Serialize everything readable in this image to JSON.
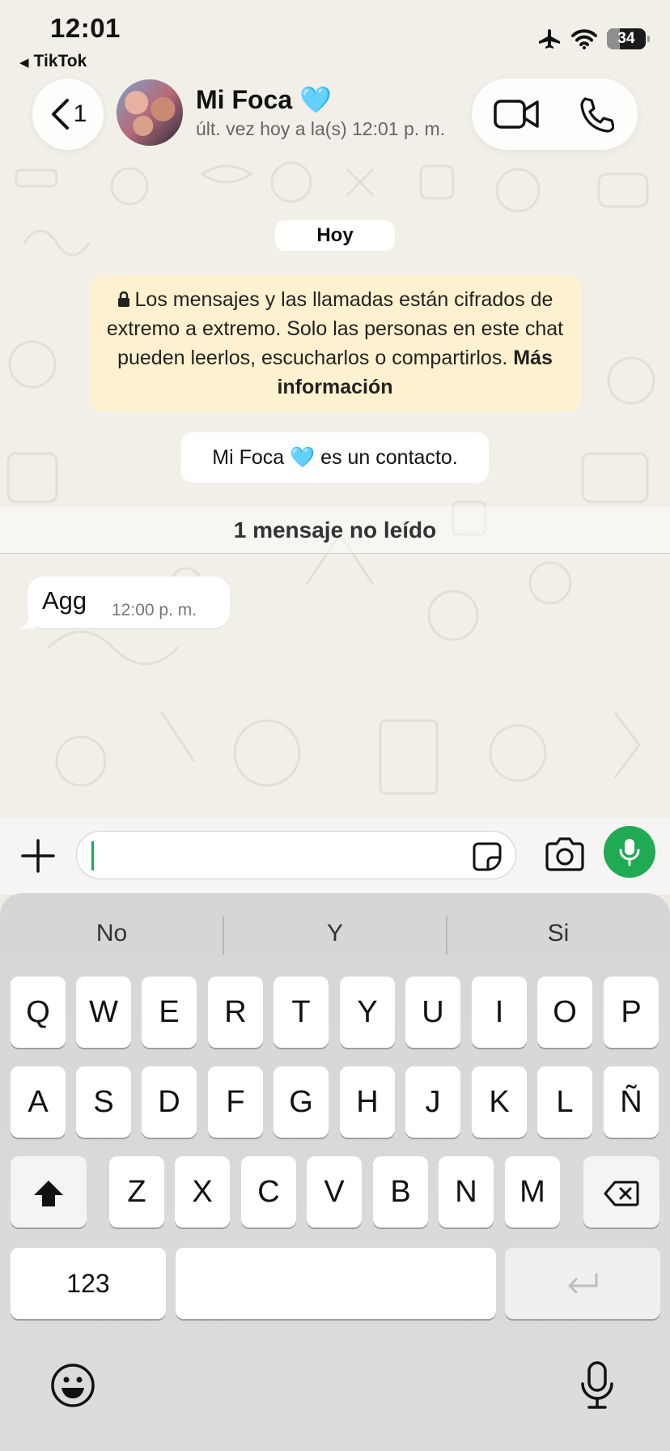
{
  "status_bar": {
    "time": "12:01",
    "back_app": "TikTok",
    "battery": "34",
    "battery_level": 0.34
  },
  "header": {
    "back_count": "1",
    "contact_name": "Mi Foca 🩵",
    "contact_status": "últ. vez hoy a la(s) 12:01 p. m."
  },
  "chat": {
    "date_label": "Hoy",
    "encryption_text": "Los mensajes y las llamadas están cifrados de extremo a extremo. Solo las personas en este chat pueden leerlos, escucharlos o compartirlos.",
    "encryption_link": "Más información",
    "contact_notice": "Mi Foca 🩵 es un contacto.",
    "unread_label": "1 mensaje no leído",
    "messages": [
      {
        "text": "Agg",
        "time": "12:00 p. m."
      }
    ]
  },
  "input": {
    "value": "",
    "placeholder": ""
  },
  "keyboard": {
    "suggestions": [
      "No",
      "Y",
      "Si"
    ],
    "row1": [
      "Q",
      "W",
      "E",
      "R",
      "T",
      "Y",
      "U",
      "I",
      "O",
      "P"
    ],
    "row2": [
      "A",
      "S",
      "D",
      "F",
      "G",
      "H",
      "J",
      "K",
      "L",
      "Ñ"
    ],
    "row3": [
      "Z",
      "X",
      "C",
      "V",
      "B",
      "N",
      "M"
    ],
    "numbers_key": "123"
  },
  "colors": {
    "accent_green": "#1faa53",
    "encryption_bg": "#fdf1cf",
    "chat_bg": "#f2efe8"
  }
}
